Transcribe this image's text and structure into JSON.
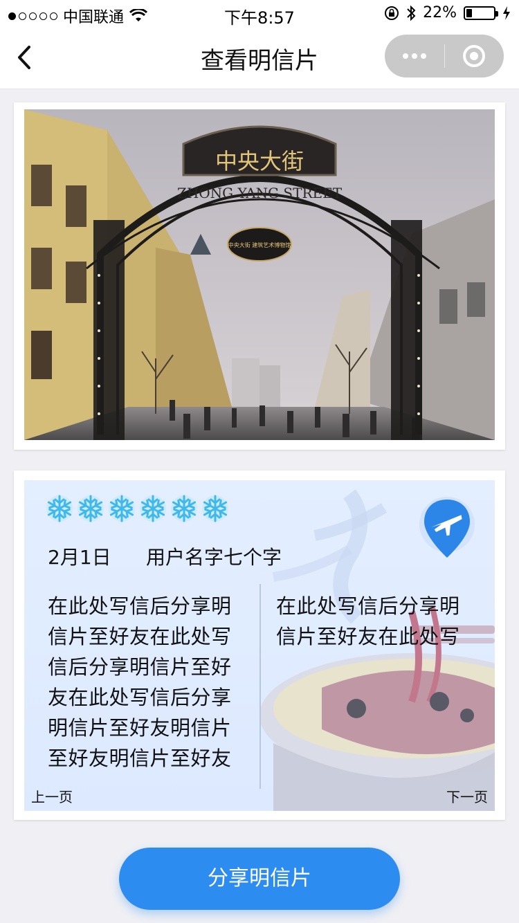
{
  "statusbar": {
    "carrier": "中国联通",
    "time": "下午8:57",
    "battery": "22%",
    "battery_level": 0.22,
    "icons": [
      "signal-dots",
      "wifi-icon",
      "orientation-lock-icon",
      "bluetooth-icon",
      "battery-icon",
      "charging-bolt-icon"
    ]
  },
  "navbar": {
    "title": "查看明信片",
    "back_icon": "chevron-left-icon",
    "more_icon": "more-dots-icon",
    "close_icon": "target-circle-icon"
  },
  "photo": {
    "sign_text": "中央大街",
    "sign_sub_text": "ZHONG YANG STREET",
    "badge_text": "中央大街 建筑艺术博物馆"
  },
  "postcard": {
    "snowflake_count": 6,
    "date": "2月1日",
    "username": "用户名字七个字",
    "stamp_icon": "airplane-pin-icon",
    "left_lines": [
      "在此处写信后分享明",
      "信片至好友在此处写",
      "信后分享明信片至好",
      "友在此处写信后分享",
      "明信片至好友明信片",
      "至好友明信片至好友"
    ],
    "right_lines": [
      "在此处写信后分享明",
      "信片至好友在此处写"
    ],
    "prev_label": "上一页",
    "next_label": "下一页"
  },
  "share_button": {
    "label": "分享明信片"
  },
  "colors": {
    "accent": "#2d8cf0",
    "card_bg": "#e3eeff",
    "page_bg": "#f0f0f4"
  }
}
